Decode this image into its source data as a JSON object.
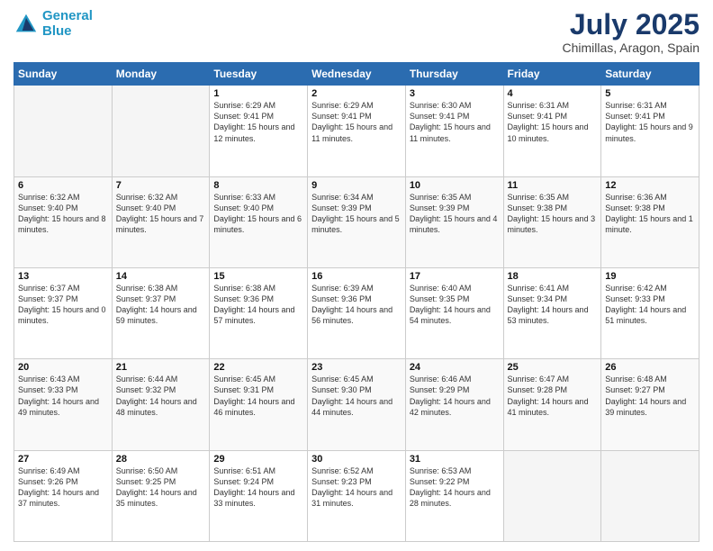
{
  "header": {
    "logo_line1": "General",
    "logo_line2": "Blue",
    "month_year": "July 2025",
    "location": "Chimillas, Aragon, Spain"
  },
  "weekdays": [
    "Sunday",
    "Monday",
    "Tuesday",
    "Wednesday",
    "Thursday",
    "Friday",
    "Saturday"
  ],
  "weeks": [
    [
      {
        "day": "",
        "info": ""
      },
      {
        "day": "",
        "info": ""
      },
      {
        "day": "1",
        "info": "Sunrise: 6:29 AM\nSunset: 9:41 PM\nDaylight: 15 hours and 12 minutes."
      },
      {
        "day": "2",
        "info": "Sunrise: 6:29 AM\nSunset: 9:41 PM\nDaylight: 15 hours and 11 minutes."
      },
      {
        "day": "3",
        "info": "Sunrise: 6:30 AM\nSunset: 9:41 PM\nDaylight: 15 hours and 11 minutes."
      },
      {
        "day": "4",
        "info": "Sunrise: 6:31 AM\nSunset: 9:41 PM\nDaylight: 15 hours and 10 minutes."
      },
      {
        "day": "5",
        "info": "Sunrise: 6:31 AM\nSunset: 9:41 PM\nDaylight: 15 hours and 9 minutes."
      }
    ],
    [
      {
        "day": "6",
        "info": "Sunrise: 6:32 AM\nSunset: 9:40 PM\nDaylight: 15 hours and 8 minutes."
      },
      {
        "day": "7",
        "info": "Sunrise: 6:32 AM\nSunset: 9:40 PM\nDaylight: 15 hours and 7 minutes."
      },
      {
        "day": "8",
        "info": "Sunrise: 6:33 AM\nSunset: 9:40 PM\nDaylight: 15 hours and 6 minutes."
      },
      {
        "day": "9",
        "info": "Sunrise: 6:34 AM\nSunset: 9:39 PM\nDaylight: 15 hours and 5 minutes."
      },
      {
        "day": "10",
        "info": "Sunrise: 6:35 AM\nSunset: 9:39 PM\nDaylight: 15 hours and 4 minutes."
      },
      {
        "day": "11",
        "info": "Sunrise: 6:35 AM\nSunset: 9:38 PM\nDaylight: 15 hours and 3 minutes."
      },
      {
        "day": "12",
        "info": "Sunrise: 6:36 AM\nSunset: 9:38 PM\nDaylight: 15 hours and 1 minute."
      }
    ],
    [
      {
        "day": "13",
        "info": "Sunrise: 6:37 AM\nSunset: 9:37 PM\nDaylight: 15 hours and 0 minutes."
      },
      {
        "day": "14",
        "info": "Sunrise: 6:38 AM\nSunset: 9:37 PM\nDaylight: 14 hours and 59 minutes."
      },
      {
        "day": "15",
        "info": "Sunrise: 6:38 AM\nSunset: 9:36 PM\nDaylight: 14 hours and 57 minutes."
      },
      {
        "day": "16",
        "info": "Sunrise: 6:39 AM\nSunset: 9:36 PM\nDaylight: 14 hours and 56 minutes."
      },
      {
        "day": "17",
        "info": "Sunrise: 6:40 AM\nSunset: 9:35 PM\nDaylight: 14 hours and 54 minutes."
      },
      {
        "day": "18",
        "info": "Sunrise: 6:41 AM\nSunset: 9:34 PM\nDaylight: 14 hours and 53 minutes."
      },
      {
        "day": "19",
        "info": "Sunrise: 6:42 AM\nSunset: 9:33 PM\nDaylight: 14 hours and 51 minutes."
      }
    ],
    [
      {
        "day": "20",
        "info": "Sunrise: 6:43 AM\nSunset: 9:33 PM\nDaylight: 14 hours and 49 minutes."
      },
      {
        "day": "21",
        "info": "Sunrise: 6:44 AM\nSunset: 9:32 PM\nDaylight: 14 hours and 48 minutes."
      },
      {
        "day": "22",
        "info": "Sunrise: 6:45 AM\nSunset: 9:31 PM\nDaylight: 14 hours and 46 minutes."
      },
      {
        "day": "23",
        "info": "Sunrise: 6:45 AM\nSunset: 9:30 PM\nDaylight: 14 hours and 44 minutes."
      },
      {
        "day": "24",
        "info": "Sunrise: 6:46 AM\nSunset: 9:29 PM\nDaylight: 14 hours and 42 minutes."
      },
      {
        "day": "25",
        "info": "Sunrise: 6:47 AM\nSunset: 9:28 PM\nDaylight: 14 hours and 41 minutes."
      },
      {
        "day": "26",
        "info": "Sunrise: 6:48 AM\nSunset: 9:27 PM\nDaylight: 14 hours and 39 minutes."
      }
    ],
    [
      {
        "day": "27",
        "info": "Sunrise: 6:49 AM\nSunset: 9:26 PM\nDaylight: 14 hours and 37 minutes."
      },
      {
        "day": "28",
        "info": "Sunrise: 6:50 AM\nSunset: 9:25 PM\nDaylight: 14 hours and 35 minutes."
      },
      {
        "day": "29",
        "info": "Sunrise: 6:51 AM\nSunset: 9:24 PM\nDaylight: 14 hours and 33 minutes."
      },
      {
        "day": "30",
        "info": "Sunrise: 6:52 AM\nSunset: 9:23 PM\nDaylight: 14 hours and 31 minutes."
      },
      {
        "day": "31",
        "info": "Sunrise: 6:53 AM\nSunset: 9:22 PM\nDaylight: 14 hours and 28 minutes."
      },
      {
        "day": "",
        "info": ""
      },
      {
        "day": "",
        "info": ""
      }
    ]
  ]
}
